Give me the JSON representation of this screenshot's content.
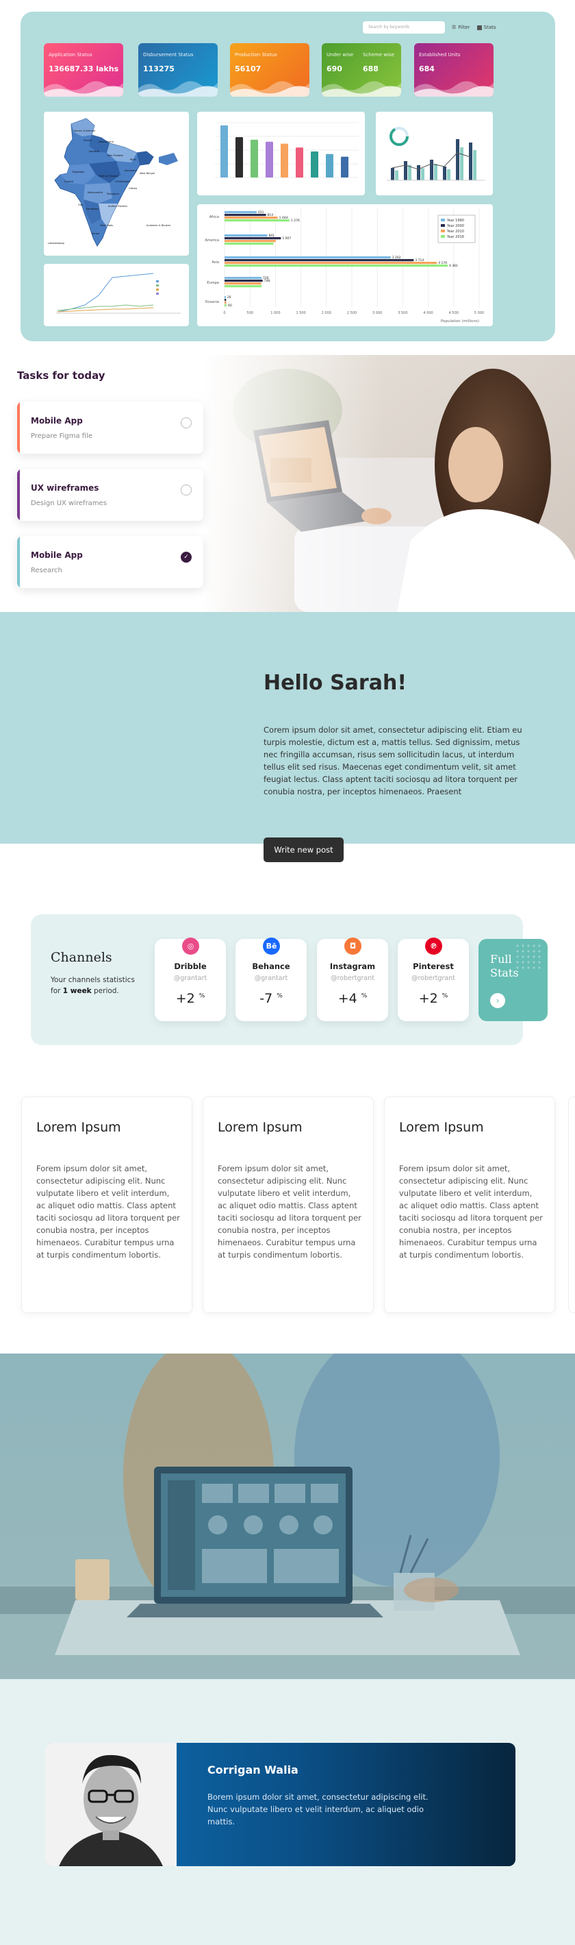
{
  "dashboard": {
    "search_placeholder": "Search by keywords",
    "filter_label": "Filter",
    "stats_label": "Stats",
    "cards": [
      {
        "label": "Application Status",
        "value": "136687.33 lakhs",
        "color1": "#ff5a7a",
        "color2": "#e0308f"
      },
      {
        "label": "Disbursement Status",
        "value": "113275",
        "color1": "#2a6ca8",
        "color2": "#1a9ad1"
      },
      {
        "label": "Production Status",
        "value": "56107",
        "color1": "#f7a21b",
        "color2": "#f06a22"
      },
      {
        "label": "Under wise",
        "value": "690",
        "label2": "Scheme wise",
        "value2": "688",
        "color1": "#4e9e2d",
        "color2": "#89c43c"
      },
      {
        "label": "Established Units",
        "value": "684",
        "color1": "#9c2b8c",
        "color2": "#e2386a"
      }
    ],
    "map_labels": [
      "Jammu & Kashmir",
      "Punjab",
      "Uttarakhand",
      "Haryana",
      "Rajasthan",
      "Uttar Pradesh",
      "Bihar",
      "Jharkhand",
      "West Bengal",
      "Madhya Pradesh",
      "Gujarat",
      "Chhattisgarh",
      "Odisha",
      "Maharashtra",
      "Telangana",
      "Karnataka",
      "Goa",
      "Andhra Pradesh",
      "Tamil Nadu",
      "Kerala",
      "Andaman & Nicobar",
      "Lakshadweep"
    ],
    "hbar": {
      "categories": [
        "Africa",
        "America",
        "Asia",
        "Europe",
        "Oceania"
      ],
      "series": [
        {
          "name": "Year 1990",
          "values": [
            631,
            841,
            3262,
            726,
            26
          ],
          "color": "#79b8e3"
        },
        {
          "name": "Year 2000",
          "values": [
            814,
            1107,
            3714,
            748,
            31
          ],
          "color": "#2b2b4b"
        },
        {
          "name": "Year 2010",
          "values": [
            1044,
            1007,
            4170,
            720,
            35
          ],
          "color": "#f7a35c"
        },
        {
          "name": "Year 2016",
          "values": [
            1276,
            961,
            4381,
            728,
            40
          ],
          "color": "#90ed7d"
        }
      ],
      "data_labels": [
        "631",
        "814",
        "1 044",
        "1 276",
        "841",
        "1 007",
        "3 262",
        "3 714",
        "4 170",
        "4 381",
        "726",
        "748",
        "26",
        "40"
      ],
      "axis_ticks": [
        "0",
        "500",
        "1 000",
        "1 500",
        "2 000",
        "2 500",
        "3 000",
        "3 500",
        "4 000",
        "4 500",
        "5 000"
      ],
      "xlabel": "Population (millions)"
    }
  },
  "tasks": {
    "title": "Tasks for today",
    "items": [
      {
        "title": "Mobile App",
        "subtitle": "Prepare Figma file",
        "color": "#ff7a59",
        "done": false
      },
      {
        "title": "UX wireframes",
        "subtitle": "Design UX wireframes",
        "color": "#7b3a8f",
        "done": false
      },
      {
        "title": "Mobile App",
        "subtitle": "Research",
        "color": "#7fc6cf",
        "done": true
      }
    ]
  },
  "hello": {
    "heading": "Hello Sarah!",
    "body": "Corem ipsum dolor sit amet, consectetur adipiscing elit. Etiam eu turpis molestie, dictum est a, mattis tellus. Sed dignissim, metus nec fringilla accumsan, risus sem sollicitudin lacus, ut interdum tellus elit sed risus. Maecenas eget condimentum velit, sit amet feugiat lectus. Class aptent taciti sociosqu ad litora torquent per conubia nostra, per inceptos himenaeos. Praesent",
    "button": "Write new post"
  },
  "channels": {
    "title": "Channels",
    "desc_prefix": "Your channels statistics for ",
    "desc_bold": "1 week",
    "desc_suffix": " period.",
    "items": [
      {
        "name": "Dribble",
        "handle": "@grantart",
        "change": "+2",
        "unit": "%",
        "color": "#ea4c89",
        "glyph": "◎"
      },
      {
        "name": "Behance",
        "handle": "@grantart",
        "change": "-7",
        "unit": "%",
        "color": "#1769ff",
        "glyph": "Bē"
      },
      {
        "name": "Instagram",
        "handle": "@robertgrant",
        "change": "+4",
        "unit": "%",
        "color": "#f77737",
        "glyph": "◘"
      },
      {
        "name": "Pinterest",
        "handle": "@robertgrant",
        "change": "+2",
        "unit": "%",
        "color": "#e60023",
        "glyph": "℗"
      }
    ],
    "full_stats_line1": "Full",
    "full_stats_line2": "Stats",
    "arrow": "›"
  },
  "lorem_cards": [
    {
      "title": "Lorem Ipsum",
      "body": "Forem ipsum dolor sit amet, consectetur adipiscing elit. Nunc vulputate libero et velit interdum, ac aliquet odio mattis. Class aptent taciti sociosqu ad litora torquent per conubia nostra, per inceptos himenaeos. Curabitur tempus urna at turpis condimentum lobortis."
    },
    {
      "title": "Lorem Ipsum",
      "body": "Forem ipsum dolor sit amet, consectetur adipiscing elit. Nunc vulputate libero et velit interdum, ac aliquet odio mattis. Class aptent taciti sociosqu ad litora torquent per conubia nostra, per inceptos himenaeos. Curabitur tempus urna at turpis condimentum lobortis."
    },
    {
      "title": "Lorem Ipsum",
      "body": "Forem ipsum dolor sit amet, consectetur adipiscing elit. Nunc vulputate libero et velit interdum, ac aliquet odio mattis. Class aptent taciti sociosqu ad litora torquent per conubia nostra, per inceptos himenaeos. Curabitur tempus urna at turpis condimentum lobortis."
    }
  ],
  "profile": {
    "name": "Corrigan Walia",
    "bio": "Borem ipsum dolor sit amet, consectetur adipiscing elit. Nunc vulputate libero et velit interdum, ac aliquet odio mattis."
  }
}
